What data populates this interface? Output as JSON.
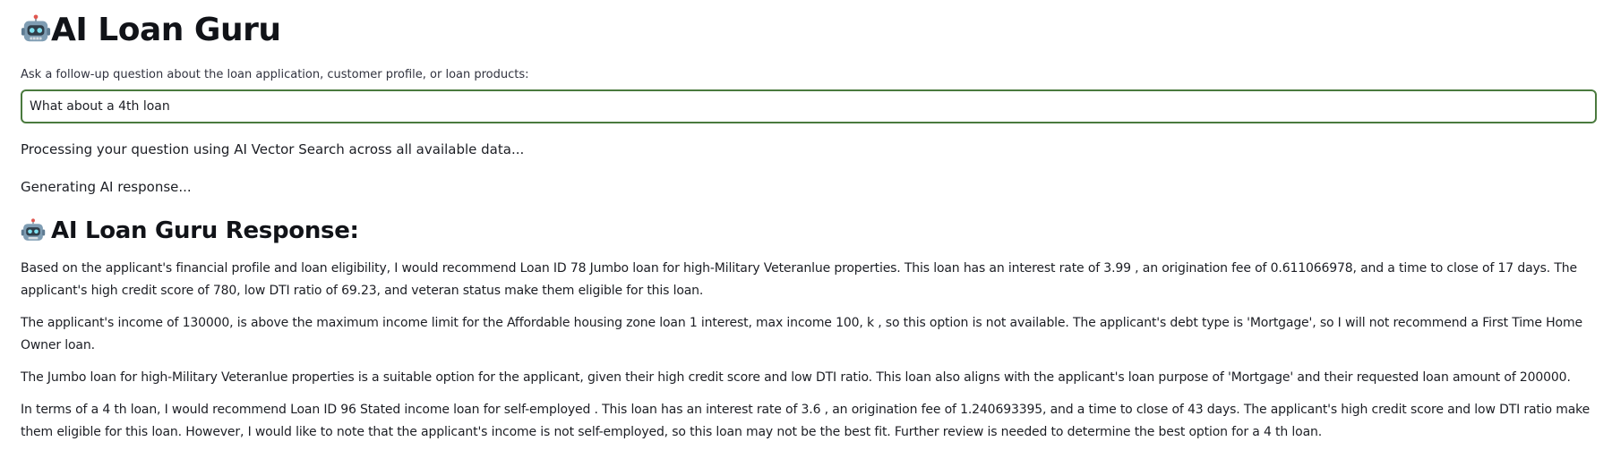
{
  "header": {
    "icon": "robot-icon",
    "title": "AI Loan Guru"
  },
  "prompt": {
    "label": "Ask a follow-up question about the loan application, customer profile, or loan products:",
    "value": "What about a 4th loan"
  },
  "status": {
    "processing": "Processing your question using AI Vector Search across all available data...",
    "generating": "Generating AI response..."
  },
  "response": {
    "icon": "robot-icon",
    "heading": "AI Loan Guru Response:",
    "paragraphs": [
      "Based on the applicant's financial profile and loan eligibility, I would recommend Loan ID 78 Jumbo loan for high-Military Veteranlue properties. This loan has an interest rate of 3.99 , an origination fee of 0.611066978, and a time to close of 17 days. The applicant's high credit score of 780, low DTI ratio of 69.23, and veteran status make them eligible for this loan.",
      "The applicant's income of 130000, is above the maximum income limit for the Affordable housing zone loan 1 interest, max income 100, k , so this option is not available. The applicant's debt type is 'Mortgage', so I will not recommend a First Time Home Owner loan.",
      "The Jumbo loan for high-Military Veteranlue properties is a suitable option for the applicant, given their high credit score and low DTI ratio. This loan also aligns with the applicant's loan purpose of 'Mortgage' and their requested loan amount of 200000.",
      "In terms of a 4 th loan, I would recommend Loan ID 96 Stated income loan for self-employed . This loan has an interest rate of 3.6 , an origination fee of 1.240693395, and a time to close of 43 days. The applicant's high credit score and low DTI ratio make them eligible for this loan. However, I would like to note that the applicant's income is not self-employed, so this loan may not be the best fit. Further review is needed to determine the best option for a 4 th loan."
    ]
  },
  "colors": {
    "input_border": "#4a7a3e",
    "text": "#1c1e24",
    "robot_body": "#6f8fa6"
  }
}
